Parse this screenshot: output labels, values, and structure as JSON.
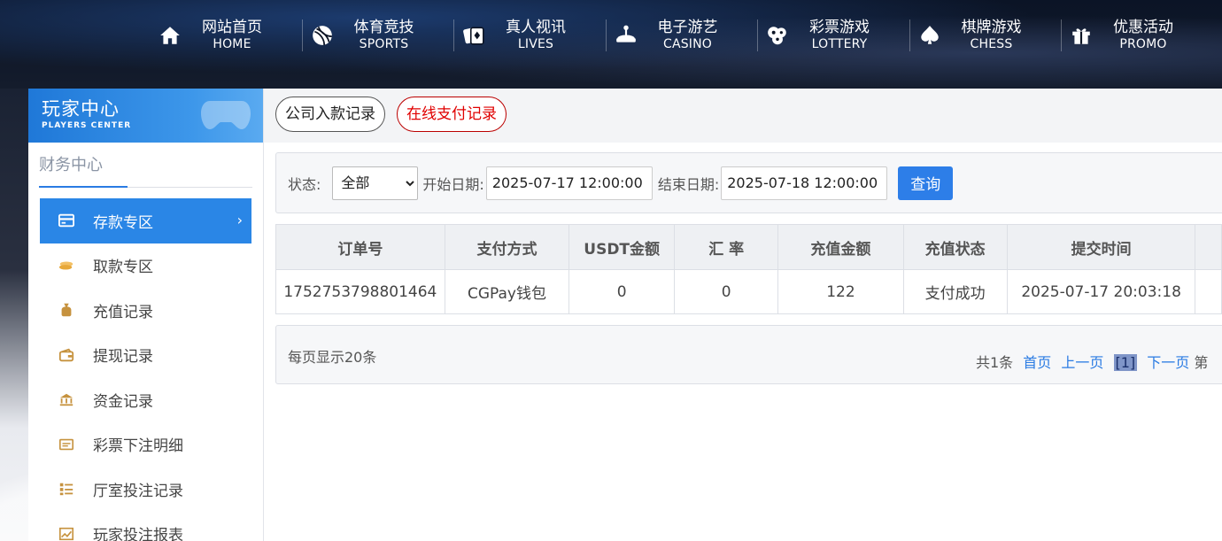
{
  "nav": [
    {
      "cn": "网站首页",
      "en": "HOME",
      "icon": "home-icon"
    },
    {
      "cn": "体育竞技",
      "en": "SPORTS",
      "icon": "ball-icon"
    },
    {
      "cn": "真人视讯",
      "en": "LIVES",
      "icon": "cards-icon"
    },
    {
      "cn": "电子游艺",
      "en": "CASINO",
      "icon": "joystick-icon"
    },
    {
      "cn": "彩票游戏",
      "en": "LOTTERY",
      "icon": "balls-icon"
    },
    {
      "cn": "棋牌游戏",
      "en": "CHESS",
      "icon": "spade-icon"
    },
    {
      "cn": "优惠活动",
      "en": "PROMO",
      "icon": "gift-icon"
    }
  ],
  "sidebar": {
    "title_cn": "玩家中心",
    "title_en": "PLAYERS CENTER",
    "section": "财务中心",
    "items": [
      {
        "label": "存款专区",
        "icon": "card-icon",
        "active": true
      },
      {
        "label": "取款专区",
        "icon": "cash-icon"
      },
      {
        "label": "充值记录",
        "icon": "money-bag-icon"
      },
      {
        "label": "提现记录",
        "icon": "wallet-icon"
      },
      {
        "label": "资金记录",
        "icon": "bank-icon"
      },
      {
        "label": "彩票下注明细",
        "icon": "ticket-icon"
      },
      {
        "label": "厅室投注记录",
        "icon": "list-icon"
      },
      {
        "label": "玩家投注报表",
        "icon": "chart-icon"
      }
    ]
  },
  "tabs": [
    {
      "label": "公司入款记录"
    },
    {
      "label": "在线支付记录",
      "active": true
    }
  ],
  "filter": {
    "status_label": "状态:",
    "status_value": "全部",
    "start_label": "开始日期:",
    "start_value": "2025-07-17 12:00:00",
    "end_label": "结束日期:",
    "end_value": "2025-07-18 12:00:00",
    "query_label": "查询"
  },
  "table": {
    "headers": [
      "订单号",
      "支付方式",
      "USDT金额",
      "汇 率",
      "充值金额",
      "充值状态",
      "提交时间"
    ],
    "rows": [
      [
        "1752753798801464",
        "CGPay钱包",
        "0",
        "0",
        "122",
        "支付成功",
        "2025-07-17 20:03:18"
      ]
    ]
  },
  "pager": {
    "per_page": "每页显示20条",
    "total": "共1条",
    "first": "首页",
    "prev": "上一页",
    "current": "[1]",
    "next": "下一页",
    "tail": "第"
  },
  "colors": {
    "accent": "#2a86e6",
    "active_tab": "#e00000"
  }
}
